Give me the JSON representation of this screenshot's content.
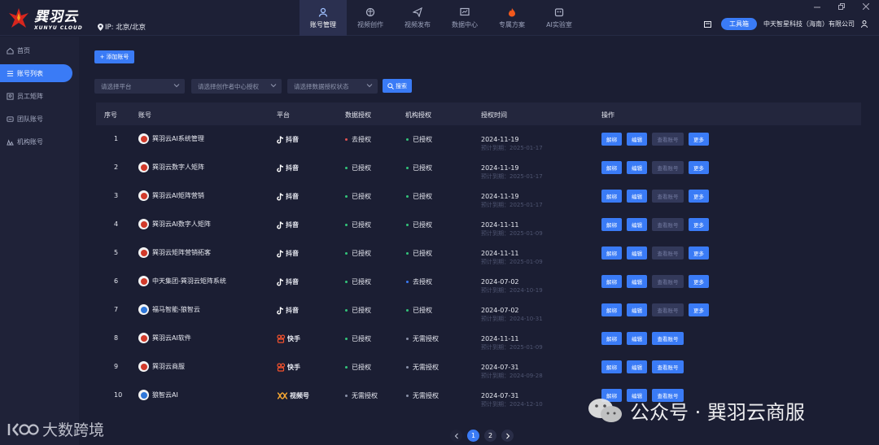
{
  "brand": {
    "name_cn": "巽羽云",
    "name_en": "XUNYU CLOUD",
    "ip_label": "IP: 北京/北京"
  },
  "nav": [
    {
      "label": "账号管理",
      "icon": "user-icon",
      "active": true
    },
    {
      "label": "视频创作",
      "icon": "brain-icon"
    },
    {
      "label": "视频发布",
      "icon": "send-icon"
    },
    {
      "label": "数据中心",
      "icon": "chart-icon"
    },
    {
      "label": "专属方案",
      "icon": "flame-icon"
    },
    {
      "label": "AI实验室",
      "icon": "robot-icon"
    }
  ],
  "topright": {
    "tool_label": "工具箱",
    "company": "中天智星科技（海南）有限公司"
  },
  "sidebar": [
    {
      "label": "首页",
      "icon": "home-icon"
    },
    {
      "label": "账号列表",
      "icon": "list-icon",
      "active": true
    },
    {
      "label": "员工矩阵",
      "icon": "employee-icon"
    },
    {
      "label": "团队账号",
      "icon": "team-icon"
    },
    {
      "label": "机构账号",
      "icon": "org-icon"
    }
  ],
  "toolbar": {
    "add_label": "添加账号",
    "search_label": "搜索"
  },
  "filters": [
    "请选择平台",
    "请选择创作者中心授权",
    "请选择数据授权状态"
  ],
  "table": {
    "headers": [
      "序号",
      "账号",
      "平台",
      "数据授权",
      "机构授权",
      "授权时间",
      "操作"
    ],
    "buttons": {
      "unbind": "解绑",
      "edit": "编辑",
      "view": "查看账号",
      "more": "更多"
    },
    "rows": [
      {
        "seq": "1",
        "account": "巽羽云AI系统管理",
        "platform": "抖音",
        "data_auth": "去授权",
        "org_auth": "已授权",
        "date": "2024-11-19",
        "expire": "预计到期：2025-01-17",
        "view_enabled": false,
        "more": true,
        "data_color": "#e05252",
        "org_color": "#33c47a",
        "av": "red"
      },
      {
        "seq": "2",
        "account": "巽羽云数字人矩阵",
        "platform": "抖音",
        "data_auth": "已授权",
        "org_auth": "已授权",
        "date": "2024-11-19",
        "expire": "预计到期：2025-01-17",
        "view_enabled": false,
        "more": true,
        "data_color": "#33c47a",
        "org_color": "#33c47a",
        "av": "red"
      },
      {
        "seq": "3",
        "account": "巽羽云AI矩阵营销",
        "platform": "抖音",
        "data_auth": "已授权",
        "org_auth": "已授权",
        "date": "2024-11-19",
        "expire": "预计到期：2025-01-17",
        "view_enabled": false,
        "more": true,
        "data_color": "#33c47a",
        "org_color": "#33c47a",
        "av": "red"
      },
      {
        "seq": "4",
        "account": "巽羽云AI数字人矩阵",
        "platform": "抖音",
        "data_auth": "已授权",
        "org_auth": "已授权",
        "date": "2024-11-11",
        "expire": "预计到期：2025-01-09",
        "view_enabled": false,
        "more": true,
        "data_color": "#33c47a",
        "org_color": "#33c47a",
        "av": "red"
      },
      {
        "seq": "5",
        "account": "巽羽云矩阵营销拓客",
        "platform": "抖音",
        "data_auth": "已授权",
        "org_auth": "已授权",
        "date": "2024-11-11",
        "expire": "预计到期：2025-01-09",
        "view_enabled": false,
        "more": true,
        "data_color": "#33c47a",
        "org_color": "#33c47a",
        "av": "red"
      },
      {
        "seq": "6",
        "account": "中天集团-巽羽云矩阵系统",
        "platform": "抖音",
        "data_auth": "已授权",
        "org_auth": "去授权",
        "date": "2024-07-02",
        "expire": "预计到期：2024-10-19",
        "view_enabled": false,
        "more": true,
        "data_color": "#33c47a",
        "org_color": "#3a7bf6",
        "av": "red"
      },
      {
        "seq": "7",
        "account": "福马智能-狼智云",
        "platform": "抖音",
        "data_auth": "已授权",
        "org_auth": "已授权",
        "date": "2024-07-02",
        "expire": "预计到期：2024-10-31",
        "view_enabled": false,
        "more": true,
        "data_color": "#33c47a",
        "org_color": "#33c47a",
        "av": "blue"
      },
      {
        "seq": "8",
        "account": "巽羽云AI软件",
        "platform": "快手",
        "data_auth": "已授权",
        "org_auth": "无需授权",
        "date": "2024-11-11",
        "expire": "预计到期：2025-01-09",
        "view_enabled": true,
        "more": false,
        "data_color": "#33c47a",
        "org_color": "#8a90a8",
        "av": "red"
      },
      {
        "seq": "9",
        "account": "巽羽云商服",
        "platform": "快手",
        "data_auth": "已授权",
        "org_auth": "无需授权",
        "date": "2024-07-31",
        "expire": "预计到期：2024-09-28",
        "view_enabled": true,
        "more": false,
        "data_color": "#33c47a",
        "org_color": "#8a90a8",
        "av": "red"
      },
      {
        "seq": "10",
        "account": "狼智云AI",
        "platform": "视频号",
        "data_auth": "无需授权",
        "org_auth": "无需授权",
        "date": "2024-07-31",
        "expire": "预计到期：2024-12-10",
        "view_enabled": true,
        "more": false,
        "data_color": "#8a90a8",
        "org_color": "#8a90a8",
        "av": "blue"
      }
    ]
  },
  "pagination": {
    "pages": [
      "1",
      "2"
    ],
    "current": "1"
  },
  "watermarks": {
    "wechat": "公众号 · 巽羽云商服",
    "bigdata": "大数跨境"
  }
}
